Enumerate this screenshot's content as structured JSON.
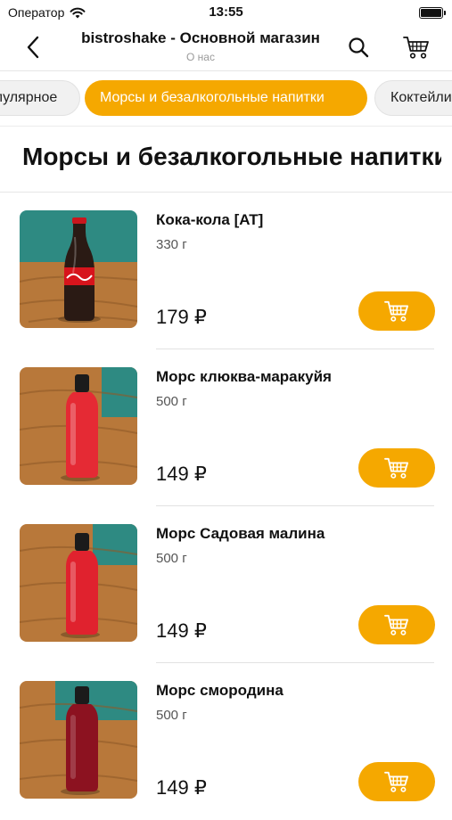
{
  "status_bar": {
    "carrier": "Оператор",
    "time": "13:55"
  },
  "nav": {
    "title": "bistroshake - Основной магазин",
    "subtitle": "О нас"
  },
  "categories": [
    {
      "label": "Популярное"
    },
    {
      "label": "Морсы и безалкогольные напитки",
      "active": true
    },
    {
      "label": "Коктейли"
    }
  ],
  "section": {
    "title": "Морсы и безалкогольные напитки"
  },
  "products": [
    {
      "name": "Кока-кола [AT]",
      "weight": "330 г",
      "price": "179 ₽"
    },
    {
      "name": "Морс клюква-маракуйя",
      "weight": "500 г",
      "price": "149 ₽"
    },
    {
      "name": "Морс Садовая малина",
      "weight": "500 г",
      "price": "149 ₽"
    },
    {
      "name": "Морс смородина",
      "weight": "500 г",
      "price": "149 ₽"
    }
  ],
  "colors": {
    "accent": "#f5a800",
    "chip_inactive": "#f1f1f1",
    "text": "#111111"
  },
  "icons": [
    "wifi-icon",
    "battery-icon",
    "back-chevron-icon",
    "search-icon",
    "cart-icon",
    "add-to-cart-icon"
  ]
}
